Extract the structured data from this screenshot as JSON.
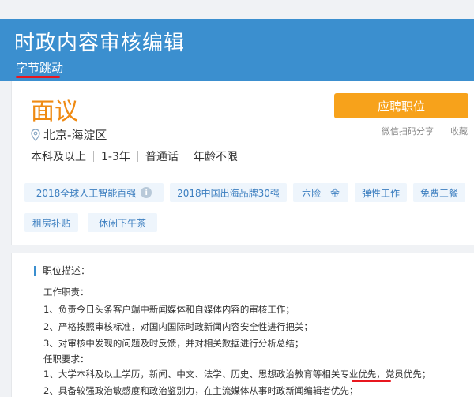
{
  "header": {
    "title": "时政内容审核编辑",
    "company": "字节跳动"
  },
  "job": {
    "salary": "面议",
    "apply_label": "应聘职位",
    "share_label": "微信扫码分享",
    "collect_label": "收藏",
    "location": "北京-海淀区",
    "requirements": [
      "本科及以上",
      "1-3年",
      "普通话",
      "年龄不限"
    ],
    "tags": [
      "2018全球人工智能百强",
      "2018中国出海品牌30强",
      "六险一金",
      "弹性工作",
      "免费三餐",
      "租房补贴",
      "休闲下午茶"
    ]
  },
  "description": {
    "title": "职位描述：",
    "lines": [
      "工作职责：",
      "1、负责今日头条客户端中新闻媒体和自媒体内容的审核工作；",
      "2、严格按照审核标准，对国内国际时政新闻内容安全性进行把关；",
      "3、对审核中发现的问题及时反馈，并对相关数据进行分析总结；",
      "任职要求：",
      "1、大学本科及以上学历，新闻、中文、法学、历史、思想政治教育等相关专业优先，党员优先；",
      "2、具备较强政治敏感度和政治鉴别力，在主流媒体从事时政新闻编辑者优先；"
    ]
  },
  "colors": {
    "header_bg": "#3b8fcf",
    "salary": "#ef8a12",
    "apply_bg": "#f7a21b",
    "tag_bg": "#eef5fc",
    "tag_text": "#3d7fc0",
    "highlight_underline": "#e8171f"
  }
}
